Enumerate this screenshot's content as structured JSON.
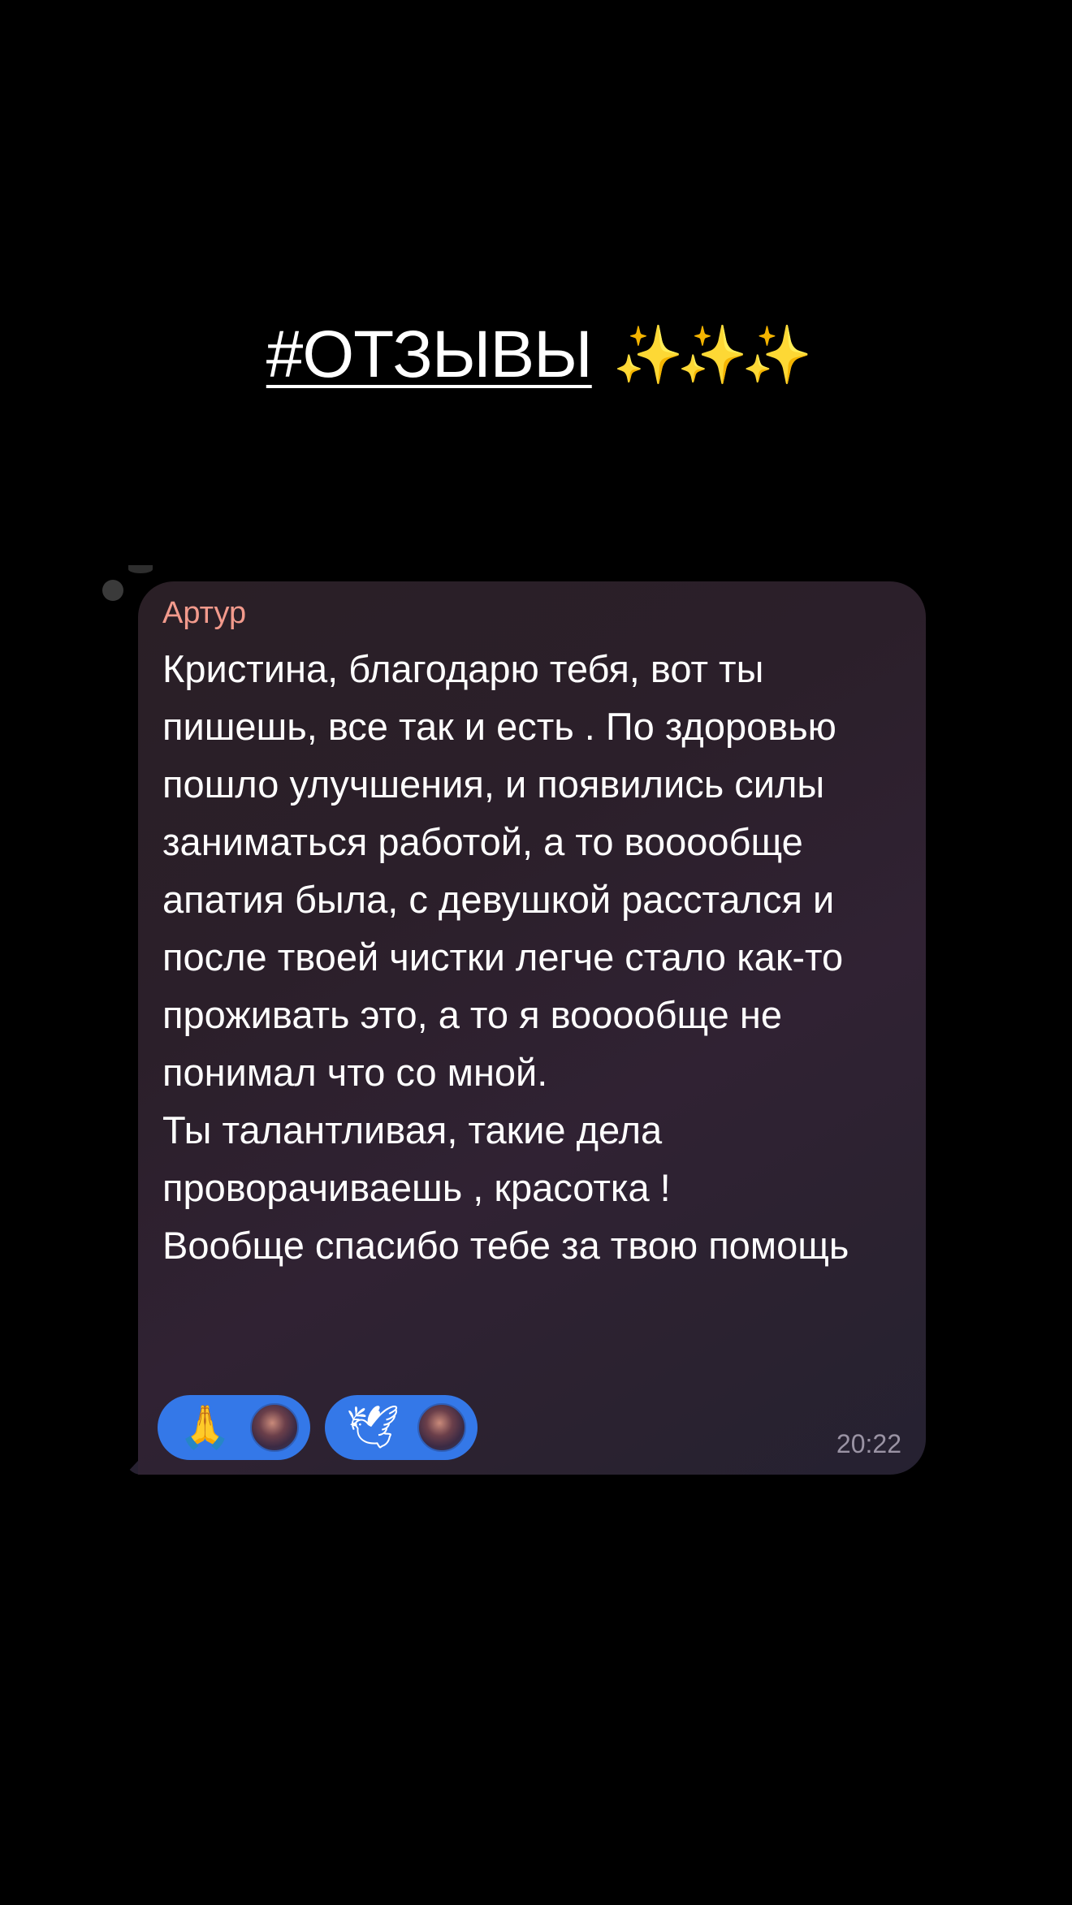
{
  "title": {
    "text": "#ОТЗЫВЫ",
    "sparkles": "✨✨✨"
  },
  "message": {
    "sender": "Артур",
    "text": "Кристина, благодарю тебя, вот ты пишешь, все так и есть . По здоровью пошло улучшения, и появились силы заниматься работой, а то вооообще апатия была, с девушкой расстался и после твоей чистки легче стало как-то проживать это, а то я вооообще не понимал что со мной.\nТы талантливая, такие дела проворачиваешь , красотка !\nВообще спасибо тебе за твою помощь",
    "time": "20:22",
    "reactions": [
      {
        "emoji": "🙏",
        "icon": "folded-hands-icon"
      },
      {
        "emoji": "🕊",
        "icon": "dove-icon"
      }
    ]
  },
  "colors": {
    "background": "#000000",
    "sender_name": "#f29a8c",
    "reaction_pill": "#3478e8",
    "timestamp": "#9a93a4"
  }
}
